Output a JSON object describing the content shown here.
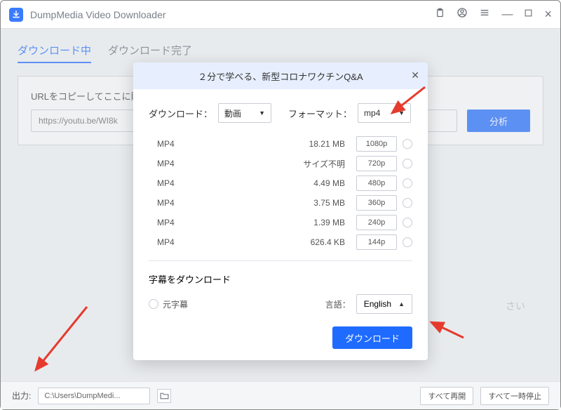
{
  "app": {
    "title": "DumpMedia Video Downloader"
  },
  "tabs": {
    "downloading": "ダウンロード中",
    "completed": "ダウンロード完了"
  },
  "urlbox": {
    "label": "URLをコピーしてここに貼り付けます",
    "value": "https://youtu.be/WI8k",
    "analyze": "分析"
  },
  "placeholder": "さい",
  "footer": {
    "output_label": "出力:",
    "output_path": "C:\\Users\\DumpMedi...",
    "resume_all": "すべて再開",
    "pause_all": "すべて一時停止"
  },
  "modal": {
    "title": "２分で学べる、新型コロナワクチンQ&A",
    "download_label": "ダウンロード：",
    "download_value": "動画",
    "format_label": "フォーマット：",
    "format_value": "mp4",
    "formats": [
      {
        "fmt": "MP4",
        "size": "18.21 MB",
        "res": "1080p"
      },
      {
        "fmt": "MP4",
        "size": "サイズ不明",
        "res": "720p"
      },
      {
        "fmt": "MP4",
        "size": "4.49 MB",
        "res": "480p"
      },
      {
        "fmt": "MP4",
        "size": "3.75 MB",
        "res": "360p"
      },
      {
        "fmt": "MP4",
        "size": "1.39 MB",
        "res": "240p"
      },
      {
        "fmt": "MP4",
        "size": "626.4 KB",
        "res": "144p"
      }
    ],
    "subtitle_title": "字幕をダウンロード",
    "subtitle_original": "元字幕",
    "lang_label": "言語：",
    "lang_value": "English",
    "download_btn": "ダウンロード"
  }
}
